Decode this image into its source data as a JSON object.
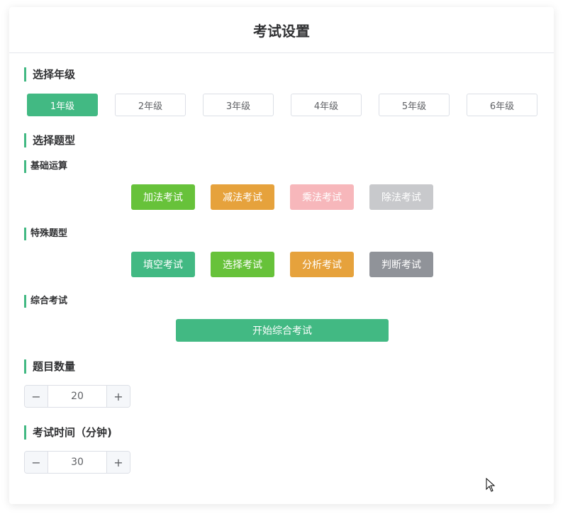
{
  "title": "考试设置",
  "grade_section": {
    "label": "选择年级",
    "grades": [
      "1年级",
      "2年级",
      "3年级",
      "4年级",
      "5年级",
      "6年级"
    ],
    "selected_index": 0
  },
  "type_section": {
    "label": "选择题型",
    "basic": {
      "label": "基础运算",
      "buttons": [
        "加法考试",
        "减法考试",
        "乘法考试",
        "除法考试"
      ]
    },
    "special": {
      "label": "特殊题型",
      "buttons": [
        "填空考试",
        "选择考试",
        "分析考试",
        "判断考试"
      ]
    },
    "comprehensive": {
      "label": "综合考试",
      "button": "开始综合考试"
    }
  },
  "count_section": {
    "label": "题目数量",
    "value": "20",
    "minus": "−",
    "plus": "+"
  },
  "time_section": {
    "label": "考试时间（分钟)",
    "value": "30",
    "minus": "−",
    "plus": "+"
  },
  "colors": {
    "accent": "#42b983",
    "add": "#67c23a",
    "subtract": "#e6a23c",
    "multiply": "#f7b7bb",
    "divide": "#c8c9cc",
    "fill": "#42b983",
    "choice": "#67c23a",
    "analysis": "#e6a23c",
    "judge": "#909399"
  }
}
